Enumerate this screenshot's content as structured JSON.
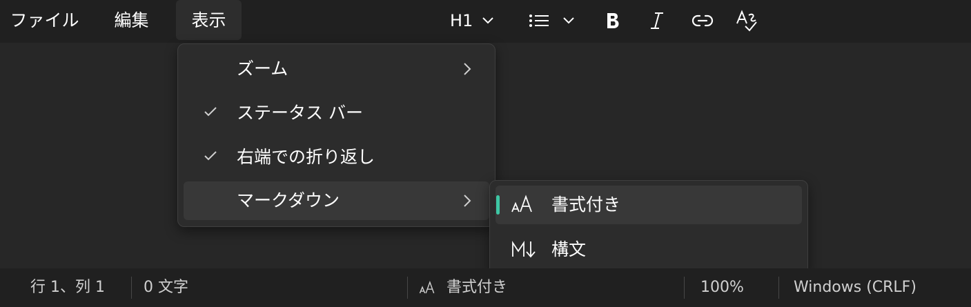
{
  "menubar": {
    "items": [
      {
        "label": "ファイル"
      },
      {
        "label": "編集"
      },
      {
        "label": "表示",
        "active": true
      }
    ]
  },
  "toolbar": {
    "heading_label": "H1",
    "icons": [
      "chevron-down-icon",
      "bullet-list-icon",
      "bold-icon",
      "italic-icon",
      "link-icon",
      "spellcheck-icon"
    ]
  },
  "view_menu": {
    "items": [
      {
        "label": "ズーム",
        "has_submenu": true,
        "checked": false
      },
      {
        "label": "ステータス バー",
        "has_submenu": false,
        "checked": true
      },
      {
        "label": "右端での折り返し",
        "has_submenu": false,
        "checked": true
      },
      {
        "label": "マークダウン",
        "has_submenu": true,
        "checked": false,
        "hovered": true
      }
    ]
  },
  "markdown_submenu": {
    "items": [
      {
        "label": "書式付き",
        "icon": "formatted-text-icon",
        "selected": true
      },
      {
        "label": "構文",
        "icon": "markdown-syntax-icon",
        "selected": false
      }
    ]
  },
  "statusbar": {
    "position": "行 1、列 1",
    "char_count": "0 文字",
    "format": "書式付き",
    "zoom": "100%",
    "line_ending": "Windows (CRLF)"
  },
  "colors": {
    "accent": "#3ec7a4",
    "background": "#272727",
    "bar": "#202020",
    "menu": "#2c2c2c"
  }
}
